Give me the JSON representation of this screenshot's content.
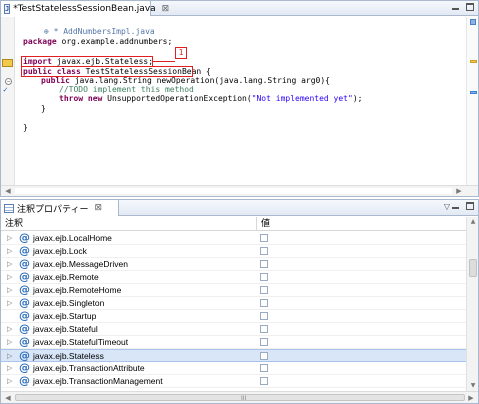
{
  "editor": {
    "tab_title": "*TestStatelessSessionBean.java",
    "tab_close": "⊠",
    "breadcrumb_marker": "⊕",
    "breadcrumb": "* AddNumbersImpl.java",
    "code": {
      "package_kw": "package",
      "package_name": " org.example.addnumbers;",
      "import_kw": "import",
      "import_name": " javax.ejb.Stateless;",
      "class_kw": "public class",
      "class_name": " TestStatelessSessionBean {",
      "method_kw": "public",
      "method_sig": " java.lang.String newOperation(java.lang.String arg0){",
      "todo_comment": "//TODO implement this method",
      "throw_kw": "throw new",
      "throw_class": " UnsupportedOperationException(",
      "throw_string": "\"Not implemented yet\"",
      "throw_end": ");",
      "close_brace_method": "}",
      "close_brace_class": "}"
    },
    "callout_number": "1"
  },
  "properties": {
    "tab_title": "注釈プロパティー",
    "tab_close": "⊠",
    "column_annotation": "注釈",
    "column_value": "値",
    "rows": [
      {
        "name": "javax.ejb.LocalHome",
        "expandable": true,
        "selected": false
      },
      {
        "name": "javax.ejb.Lock",
        "expandable": true,
        "selected": false
      },
      {
        "name": "javax.ejb.MessageDriven",
        "expandable": true,
        "selected": false
      },
      {
        "name": "javax.ejb.Remote",
        "expandable": true,
        "selected": false
      },
      {
        "name": "javax.ejb.RemoteHome",
        "expandable": true,
        "selected": false
      },
      {
        "name": "javax.ejb.Singleton",
        "expandable": true,
        "selected": false
      },
      {
        "name": "javax.ejb.Startup",
        "expandable": false,
        "selected": false
      },
      {
        "name": "javax.ejb.Stateful",
        "expandable": true,
        "selected": false
      },
      {
        "name": "javax.ejb.StatefulTimeout",
        "expandable": true,
        "selected": false
      },
      {
        "name": "javax.ejb.Stateless",
        "expandable": true,
        "selected": true
      },
      {
        "name": "javax.ejb.TransactionAttribute",
        "expandable": true,
        "selected": false
      },
      {
        "name": "javax.ejb.TransactionManagement",
        "expandable": true,
        "selected": false
      }
    ],
    "scroll_grip": "III"
  },
  "icons": {
    "java_file": "java-file-icon",
    "annotation": "at-sign-icon",
    "expander": "triangle-right-icon"
  },
  "colors": {
    "keyword": "#7f0055",
    "comment": "#3f7f5f",
    "string": "#2a00ff",
    "highlight_box": "#e02020",
    "selection": "#d8e6f8"
  }
}
